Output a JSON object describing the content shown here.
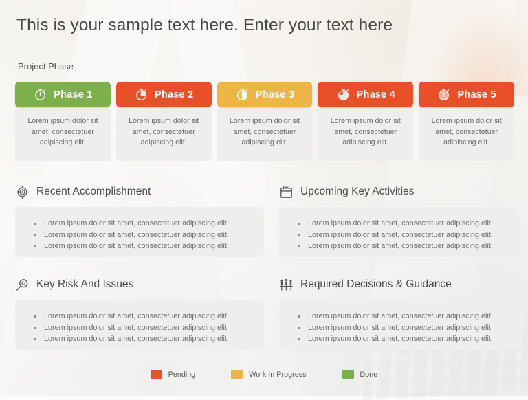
{
  "slide": {
    "title": "This is your sample text here. Enter your text here",
    "section_caption": "Project Phase"
  },
  "colors": {
    "green": "#7DAF4B",
    "red": "#E8502A",
    "amber": "#EDB545",
    "panel_gray": "#EFEEEE",
    "title_text": "#474747",
    "body_text": "#6D6D6D"
  },
  "phases": [
    {
      "label": "Phase 1",
      "icon": "stopwatch-icon",
      "status": "Done",
      "color": "#7DAF4B",
      "fill_fraction": 0,
      "body": "Lorem ipsum dolor sit amet, consectetuer adipiscing elit."
    },
    {
      "label": "Phase 2",
      "icon": "stopwatch-icon",
      "status": "Pending",
      "color": "#E8502A",
      "fill_fraction": 0.25,
      "body": "Lorem ipsum dolor sit amet, consectetuer adipiscing elit."
    },
    {
      "label": "Phase 3",
      "icon": "stopwatch-icon",
      "status": "Work In Progress",
      "color": "#EDB545",
      "fill_fraction": 0.5,
      "body": "Lorem ipsum dolor sit amet, consectetuer adipiscing elit."
    },
    {
      "label": "Phase 4",
      "icon": "stopwatch-icon",
      "status": "Pending",
      "color": "#E8502A",
      "fill_fraction": 0.75,
      "body": "Lorem ipsum dolor sit amet, consectetuer adipiscing elit."
    },
    {
      "label": "Phase 5",
      "icon": "stopwatch-icon",
      "status": "Pending",
      "color": "#E8502A",
      "fill_fraction": 1,
      "body": "Lorem ipsum dolor sit amet, consectetuer adipiscing elit."
    }
  ],
  "quadrants": [
    {
      "id": "recent-accomplishment",
      "title": "Recent Accomplishment",
      "icon": "target-icon",
      "bullets": [
        "Lorem ipsum dolor sit amet, consectetuer adipiscing elit.",
        "Lorem ipsum dolor sit amet, consectetuer adipiscing elit.",
        "Lorem ipsum dolor sit amet, consectetuer adipiscing elit."
      ]
    },
    {
      "id": "upcoming-key-activities",
      "title": "Upcoming Key Activities",
      "icon": "calendar-icon",
      "bullets": [
        "Lorem ipsum dolor sit amet, consectetuer adipiscing elit.",
        "Lorem ipsum dolor sit amet, consectetuer adipiscing elit.",
        "Lorem ipsum dolor sit amet, consectetuer adipiscing elit."
      ]
    },
    {
      "id": "key-risk-and-issues",
      "title": "Key Risk And Issues",
      "icon": "magnifier-icon",
      "bullets": [
        "Lorem ipsum dolor sit amet, consectetuer adipiscing elit.",
        "Lorem ipsum dolor sit amet, consectetuer adipiscing elit.",
        "Lorem ipsum dolor sit amet, consectetuer adipiscing elit."
      ]
    },
    {
      "id": "required-decisions-and-guidance",
      "title": "Required Decisions & Guidance",
      "icon": "meeting-icon",
      "bullets": [
        "Lorem ipsum dolor sit amet, consectetuer adipiscing elit.",
        "Lorem ipsum dolor sit amet, consectetuer adipiscing elit.",
        "Lorem ipsum dolor sit amet, consectetuer adipiscing elit."
      ]
    }
  ],
  "legend": [
    {
      "label": "Pending",
      "color": "#E8502A"
    },
    {
      "label": "Work In Progress",
      "color": "#EDB545"
    },
    {
      "label": "Done",
      "color": "#7DAF4B"
    }
  ]
}
